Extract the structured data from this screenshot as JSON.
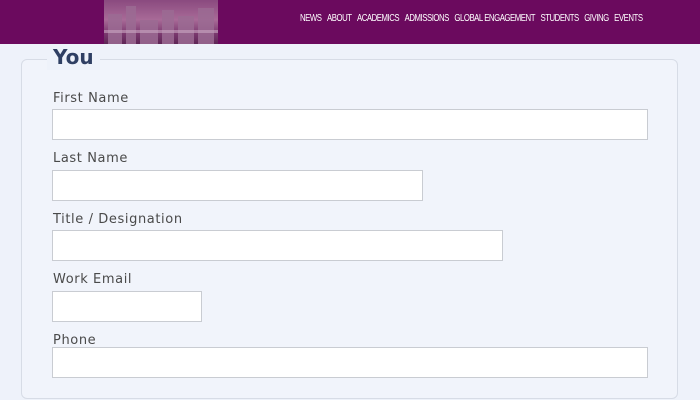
{
  "header": {
    "nav_items": [
      "NEWS",
      "ABOUT",
      "ACADEMICS",
      "ADMISSIONS",
      "GLOBAL ENGAGEMENT",
      "STUDENTS",
      "GIVING",
      "EVENTS"
    ],
    "brand_color": "#6b0a5e"
  },
  "form": {
    "legend": "You",
    "fields": [
      {
        "label": "First Name",
        "value": ""
      },
      {
        "label": "Last Name",
        "value": ""
      },
      {
        "label": "Title / Designation",
        "value": ""
      },
      {
        "label": "Work Email",
        "value": ""
      },
      {
        "label": "Phone",
        "value": ""
      }
    ]
  }
}
